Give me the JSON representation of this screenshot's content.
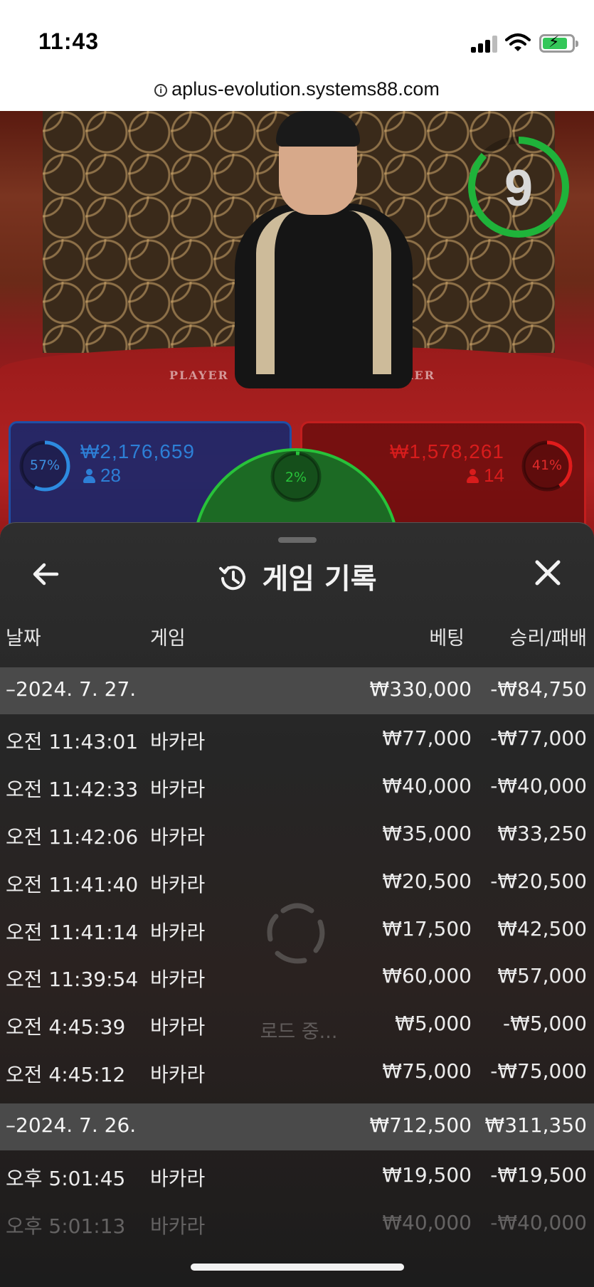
{
  "status_bar": {
    "time": "11:43",
    "battery_icon": "battery-charging-icon",
    "signal_icon": "cellular-signal-icon",
    "wifi_icon": "wifi-icon"
  },
  "browser": {
    "url": "aplus-evolution.systems88.com",
    "info_icon": "info-icon"
  },
  "game": {
    "timer_value": "9",
    "felt_labels": {
      "player": "PLAYER",
      "banker": "BANKER"
    },
    "player": {
      "percent": "57%",
      "amount": "₩2,176,659",
      "players": "28",
      "color": "#2d8be0"
    },
    "banker": {
      "percent": "41%",
      "amount": "₩1,578,261",
      "players": "14",
      "color": "#e01c1c"
    },
    "tie": {
      "percent": "2%",
      "color": "#28c23a"
    }
  },
  "history": {
    "title": "게임 기록",
    "back_icon": "arrow-left-icon",
    "history_icon": "history-clock-icon",
    "close_icon": "close-icon",
    "columns": {
      "date": "날짜",
      "game": "게임",
      "bet": "베팅",
      "win_loss": "승리/패배"
    },
    "groups": [
      {
        "date": "–2024. 7. 27.",
        "bet": "₩330,000",
        "win_loss": "-₩84,750",
        "rows": [
          {
            "time": "오전 11:43:01",
            "game": "바카라",
            "bet": "₩77,000",
            "win_loss": "-₩77,000"
          },
          {
            "time": "오전 11:42:33",
            "game": "바카라",
            "bet": "₩40,000",
            "win_loss": "-₩40,000"
          },
          {
            "time": "오전 11:42:06",
            "game": "바카라",
            "bet": "₩35,000",
            "win_loss": "₩33,250"
          },
          {
            "time": "오전 11:41:40",
            "game": "바카라",
            "bet": "₩20,500",
            "win_loss": "-₩20,500"
          },
          {
            "time": "오전 11:41:14",
            "game": "바카라",
            "bet": "₩17,500",
            "win_loss": "₩42,500"
          },
          {
            "time": "오전 11:39:54",
            "game": "바카라",
            "bet": "₩60,000",
            "win_loss": "₩57,000"
          },
          {
            "time": "오전 4:45:39",
            "game": "바카라",
            "bet": "₩5,000",
            "win_loss": "-₩5,000"
          },
          {
            "time": "오전 4:45:12",
            "game": "바카라",
            "bet": "₩75,000",
            "win_loss": "-₩75,000"
          }
        ]
      },
      {
        "date": "–2024. 7. 26.",
        "bet": "₩712,500",
        "win_loss": "₩311,350",
        "rows": [
          {
            "time": "오후 5:01:45",
            "game": "바카라",
            "bet": "₩19,500",
            "win_loss": "-₩19,500"
          },
          {
            "time": "오후 5:01:13",
            "game": "바카라",
            "bet": "₩40,000",
            "win_loss": "-₩40,000"
          }
        ]
      }
    ],
    "loading_text": "로드 중...",
    "spinner_icon": "loading-spinner-icon"
  }
}
